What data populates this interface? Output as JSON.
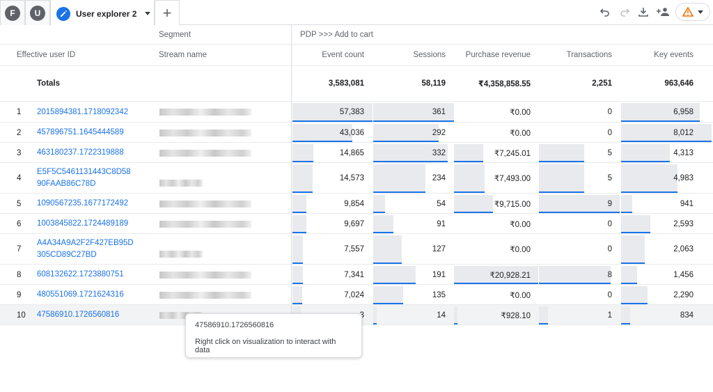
{
  "tabs": {
    "avatars": [
      "F",
      "U"
    ],
    "active_label": "User explorer 2"
  },
  "colors": {
    "accent": "#1a73e8",
    "bar": "#e8eaed",
    "warning": "#e8710a"
  },
  "header": {
    "segment_label": "Segment",
    "segment_value": "PDP >>> Add to cart",
    "columns": [
      "Effective user ID",
      "Stream name",
      "Event count",
      "Sessions",
      "Purchase revenue",
      "Transactions",
      "Key events"
    ]
  },
  "totals": {
    "label": "Totals",
    "event_count": "3,583,081",
    "sessions": "58,119",
    "purchase_revenue": "₹4,358,858.55",
    "transactions": "2,251",
    "key_events": "963,646"
  },
  "rows": [
    {
      "rank": "1",
      "user_id": "2015894381.1718092342",
      "event_count": "57,383",
      "sessions": "361",
      "purchase_revenue": "₹0.00",
      "transactions": "0",
      "key_events": "6,958",
      "bars": {
        "ev": 1.0,
        "se": 1.0,
        "pr": 0,
        "tr": 0,
        "ke": 0.87
      }
    },
    {
      "rank": "2",
      "user_id": "457896751.1645444589",
      "event_count": "43,036",
      "sessions": "292",
      "purchase_revenue": "₹0.00",
      "transactions": "0",
      "key_events": "8,012",
      "bars": {
        "ev": 0.75,
        "se": 0.81,
        "pr": 0,
        "tr": 0,
        "ke": 1.0
      }
    },
    {
      "rank": "3",
      "user_id": "463180237.1722319888",
      "event_count": "14,865",
      "sessions": "332",
      "purchase_revenue": "₹7,245.01",
      "transactions": "5",
      "key_events": "4,313",
      "bars": {
        "ev": 0.26,
        "se": 0.92,
        "pr": 0.35,
        "tr": 0.56,
        "ke": 0.54
      }
    },
    {
      "rank": "4",
      "user_id_lines": [
        "E5F5C5461131443C8D58",
        "90FAAB86C78D"
      ],
      "event_count": "14,573",
      "sessions": "234",
      "purchase_revenue": "₹7,493.00",
      "transactions": "5",
      "key_events": "4,983",
      "bars": {
        "ev": 0.25,
        "se": 0.65,
        "pr": 0.36,
        "tr": 0.56,
        "ke": 0.62
      }
    },
    {
      "rank": "5",
      "user_id": "1090567235.1677172492",
      "event_count": "9,854",
      "sessions": "54",
      "purchase_revenue": "₹9,715.00",
      "transactions": "9",
      "key_events": "941",
      "bars": {
        "ev": 0.17,
        "se": 0.15,
        "pr": 0.46,
        "tr": 1.0,
        "ke": 0.12
      }
    },
    {
      "rank": "6",
      "user_id": "1003845822.1724489189",
      "event_count": "9,697",
      "sessions": "91",
      "purchase_revenue": "₹0.00",
      "transactions": "0",
      "key_events": "2,593",
      "bars": {
        "ev": 0.17,
        "se": 0.25,
        "pr": 0,
        "tr": 0,
        "ke": 0.32
      }
    },
    {
      "rank": "7",
      "user_id_lines": [
        "A4A34A9A2F2F427EB95D",
        "305CD89C27BD"
      ],
      "event_count": "7,557",
      "sessions": "127",
      "purchase_revenue": "₹0.00",
      "transactions": "0",
      "key_events": "2,063",
      "bars": {
        "ev": 0.13,
        "se": 0.35,
        "pr": 0,
        "tr": 0,
        "ke": 0.26
      }
    },
    {
      "rank": "8",
      "user_id": "608132622.1723880751",
      "event_count": "7,341",
      "sessions": "191",
      "purchase_revenue": "₹20,928.21",
      "transactions": "8",
      "key_events": "1,456",
      "bars": {
        "ev": 0.13,
        "se": 0.53,
        "pr": 1.0,
        "tr": 0.89,
        "ke": 0.18
      }
    },
    {
      "rank": "9",
      "user_id": "480551069.1721624316",
      "event_count": "7,024",
      "sessions": "135",
      "purchase_revenue": "₹0.00",
      "transactions": "0",
      "key_events": "2,290",
      "bars": {
        "ev": 0.12,
        "se": 0.37,
        "pr": 0,
        "tr": 0,
        "ke": 0.29
      }
    },
    {
      "rank": "10",
      "user_id": "47586910.1726560816",
      "event_count": "3",
      "sessions": "14",
      "purchase_revenue": "₹928.10",
      "transactions": "1",
      "key_events": "834",
      "bars": {
        "ev": 0.1,
        "se": 0.04,
        "pr": 0.04,
        "tr": 0.11,
        "ke": 0.1
      }
    }
  ],
  "tooltip": {
    "title": "47586910.1726560816",
    "message": "Right click on visualization to interact with data"
  }
}
